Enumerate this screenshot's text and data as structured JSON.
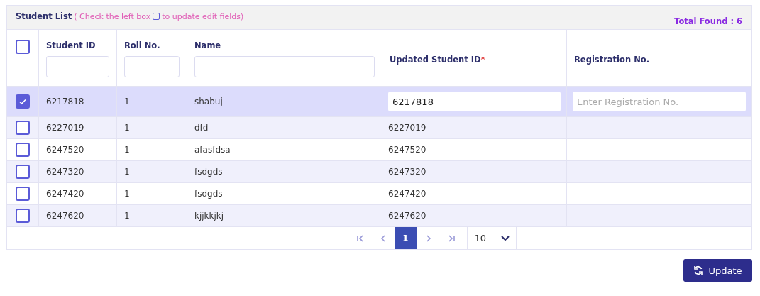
{
  "panel": {
    "title": "Student List",
    "hint_before": "( Check the left box",
    "hint_after": "to update edit fields)",
    "total": "Total Found : 6"
  },
  "table": {
    "select_all": {
      "checked": false
    },
    "columns": [
      {
        "label": "Student ID",
        "filter": true
      },
      {
        "label": "Roll No.",
        "filter": true
      },
      {
        "label": "Name",
        "filter": true
      },
      {
        "label": "Updated Student ID",
        "filter": false,
        "required_mark": "*"
      },
      {
        "label": "Registration No.",
        "filter": false
      }
    ],
    "rows": [
      {
        "selected": true,
        "student_id": "6217818",
        "roll": "1",
        "name": "shabuj",
        "updated_id": "6217818",
        "registration_placeholder": "Enter Registration No."
      },
      {
        "selected": false,
        "student_id": "6227019",
        "roll": "1",
        "name": "dfd",
        "updated_id": "6227019"
      },
      {
        "selected": false,
        "student_id": "6247520",
        "roll": "1",
        "name": "afasfdsa",
        "updated_id": "6247520"
      },
      {
        "selected": false,
        "student_id": "6247320",
        "roll": "1",
        "name": "fsdgds",
        "updated_id": "6247320"
      },
      {
        "selected": false,
        "student_id": "6247420",
        "roll": "1",
        "name": "fsdgds",
        "updated_id": "6247420"
      },
      {
        "selected": false,
        "student_id": "6247620",
        "roll": "1",
        "name": "kjjkkjkj",
        "updated_id": "6247620"
      }
    ]
  },
  "pagination": {
    "pages": [
      {
        "label": "1",
        "selected": true
      }
    ],
    "page_size": "10"
  },
  "update_button": {
    "label": "Update"
  }
}
